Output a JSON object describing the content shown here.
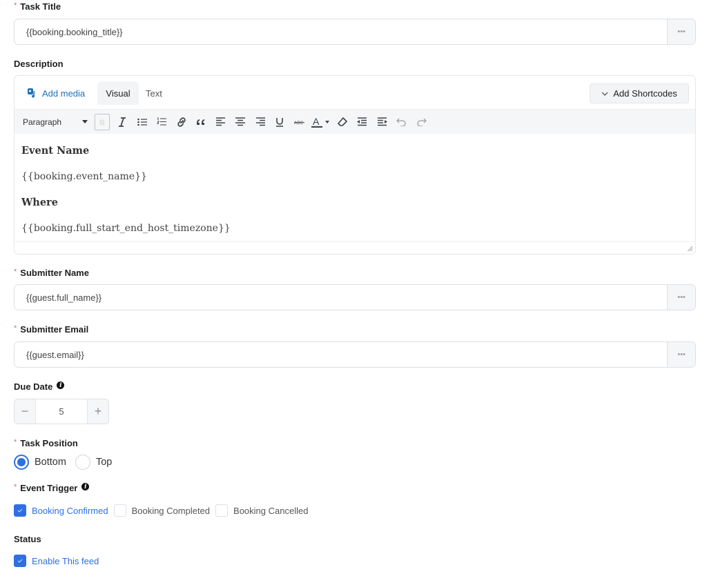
{
  "task_title": {
    "label": "Task Title",
    "required_mark": "*",
    "value": "{{booking.booking_title}}",
    "more_label": "•••"
  },
  "description": {
    "label": "Description",
    "add_media": "Add media",
    "tabs": [
      {
        "label": "Visual",
        "active": true
      },
      {
        "label": "Text",
        "active": false
      }
    ],
    "add_shortcodes": "Add Shortcodes",
    "format_select": "Paragraph",
    "toolbar_icons": [
      "bold-icon",
      "italic-icon",
      "bullet-list-icon",
      "numbered-list-icon",
      "link-icon",
      "blockquote-icon",
      "align-left-icon",
      "align-center-icon",
      "align-right-icon",
      "underline-icon",
      "strikethrough-icon",
      "text-color-icon",
      "clear-formatting-icon",
      "outdent-icon",
      "indent-icon",
      "undo-icon",
      "redo-icon"
    ],
    "content": [
      {
        "type": "heading",
        "text": "Event Name"
      },
      {
        "type": "paragraph",
        "text": "{{booking.event_name}}"
      },
      {
        "type": "heading",
        "text": "Where"
      },
      {
        "type": "paragraph",
        "text": "{{booking.full_start_end_host_timezone}}"
      }
    ]
  },
  "submitter_name": {
    "label": "Submitter Name",
    "required_mark": "*",
    "value": "{{guest.full_name}}",
    "more_label": "•••"
  },
  "submitter_email": {
    "label": "Submitter Email",
    "required_mark": "*",
    "value": "{{guest.email}}",
    "more_label": "•••"
  },
  "due_date": {
    "label": "Due Date",
    "info_glyph": "i",
    "value": "5",
    "minus": "−",
    "plus": "+"
  },
  "task_position": {
    "label": "Task Position",
    "required_mark": "*",
    "options": [
      {
        "label": "Bottom",
        "checked": true
      },
      {
        "label": "Top",
        "checked": false
      }
    ]
  },
  "event_trigger": {
    "label": "Event Trigger",
    "required_mark": "*",
    "info_glyph": "i",
    "options": [
      {
        "label": "Booking Confirmed",
        "checked": true
      },
      {
        "label": "Booking Completed",
        "checked": false
      },
      {
        "label": "Booking Cancelled",
        "checked": false
      }
    ]
  },
  "status": {
    "label": "Status",
    "options": [
      {
        "label": "Enable This feed",
        "checked": true
      }
    ]
  },
  "colors": {
    "accent": "#2f6fe0",
    "link": "#2271b1",
    "required": "#e6646e"
  }
}
